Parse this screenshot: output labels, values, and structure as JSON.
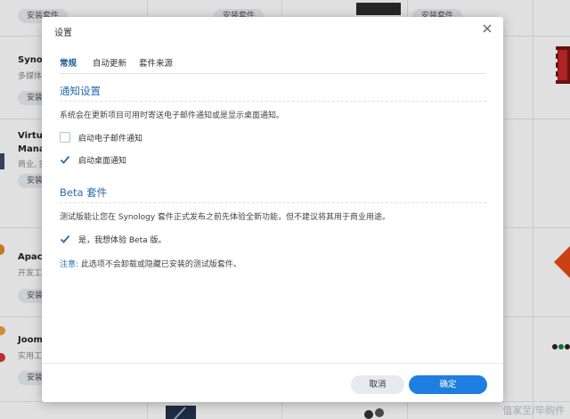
{
  "background": {
    "install_label": "安装套件",
    "packages": [
      {
        "name": "Synol",
        "category": "多媒体"
      },
      {
        "name": "Virtu",
        "name2": "Mana",
        "category": "商业, 实"
      },
      {
        "name": "Apach",
        "category": "开发工"
      },
      {
        "name": "Joom",
        "category": "实用工"
      }
    ],
    "watermark": "值家至/毕购件"
  },
  "dialog": {
    "title": "设置",
    "tabs": [
      {
        "label": "常规",
        "active": true
      },
      {
        "label": "自动更新",
        "active": false
      },
      {
        "label": "套件来源",
        "active": false
      }
    ],
    "notification": {
      "title": "通知设置",
      "description": "系统会在更新项目可用时寄送电子邮件通知或是显示桌面通知。",
      "email_label": "启动电子邮件通知",
      "email_checked": false,
      "desktop_label": "启动桌面通知",
      "desktop_checked": true
    },
    "beta": {
      "title": "Beta 套件",
      "description": "测试版能让您在 Synology 套件正式发布之前先体验全新功能，但不建议将其用于商业用途。",
      "opt_in_label": "是，我想体验 Beta 版。",
      "opt_in_checked": true,
      "note_key": "注意:",
      "note_text": "此选项不会卸载或隐藏已安装的测试版套件。"
    },
    "cancel_label": "取消",
    "ok_label": "确定"
  },
  "colors": {
    "accent": "#2a6bb0",
    "primary_button": "#1f7fe0",
    "check": "#2a6bb0"
  }
}
